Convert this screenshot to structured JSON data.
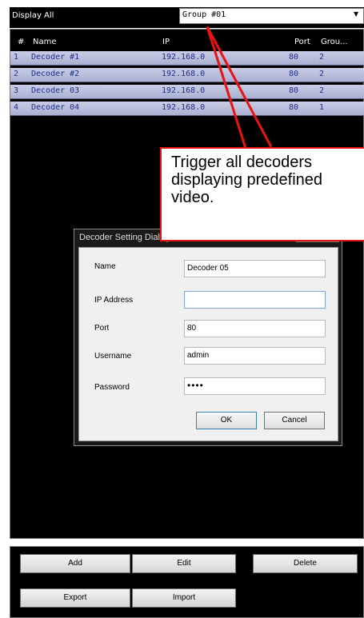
{
  "header": {
    "filter_label": "Display All",
    "group_select_value": "Group #01"
  },
  "table": {
    "columns": [
      "#",
      "Name",
      "IP",
      "Port",
      "Grou..."
    ],
    "rows": [
      {
        "num": "1",
        "name": "Decoder #1",
        "ip": "192.168.0",
        "port": "80",
        "group": "2"
      },
      {
        "num": "2",
        "name": "Decoder #2",
        "ip": "192.168.0",
        "port": "80",
        "group": "2"
      },
      {
        "num": "3",
        "name": "Decoder 03",
        "ip": "192.168.0",
        "port": "80",
        "group": "2"
      },
      {
        "num": "4",
        "name": "Decoder 04",
        "ip": "192.168.0",
        "port": "80",
        "group": "1"
      }
    ]
  },
  "callout": {
    "text": "Trigger all decoders\ndisplaying predefined\nvideo."
  },
  "dialog": {
    "title": "Decoder Setting Dialog",
    "fields": {
      "name_label": "Name",
      "name_value": "Decoder 05",
      "ip_label": "IP Address",
      "ip_value": "",
      "port_label": "Port",
      "port_value": "80",
      "username_label": "Username",
      "username_value": "admin",
      "password_label": "Password",
      "password_value": "••••"
    },
    "ok_label": "OK",
    "cancel_label": "Cancel"
  },
  "buttons": {
    "add": "Add",
    "edit": "Edit",
    "delete": "Delete",
    "export": "Export",
    "import": "Import"
  },
  "colors": {
    "row_text": "#1e2f8c",
    "callout_border": "#ee1111"
  }
}
